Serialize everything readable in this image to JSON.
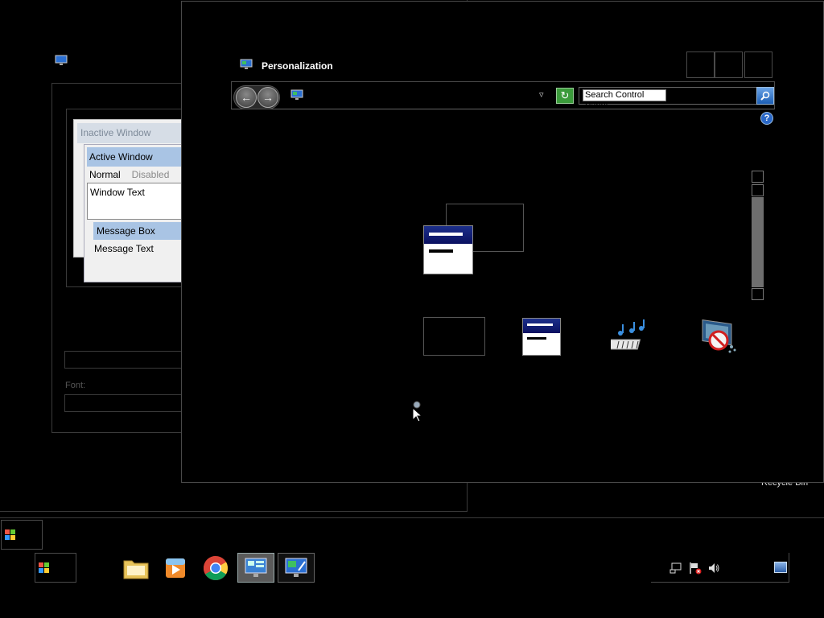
{
  "appearance_dialog": {
    "preview": {
      "inactive_window": "Inactive Window",
      "active_window": "Active Window",
      "menu_normal": "Normal",
      "menu_disabled": "Disabled",
      "window_text": "Window Text",
      "message_box": "Message Box",
      "message_text": "Message Text"
    },
    "font_label": "Font:"
  },
  "personalization": {
    "title": "Personalization",
    "search_placeholder": "Search Control Panel",
    "help": "?"
  },
  "desktop": {
    "recycle_bin_label": "Recycle Bin"
  },
  "taskbar": {
    "pinned": [
      "file-explorer",
      "media-player",
      "chrome",
      "control-panel",
      "personalization"
    ]
  },
  "colors": {
    "accent_blue": "#1c2f8a",
    "selection_blue": "#a9c4e4",
    "refresh_green": "#3b9b3b"
  }
}
